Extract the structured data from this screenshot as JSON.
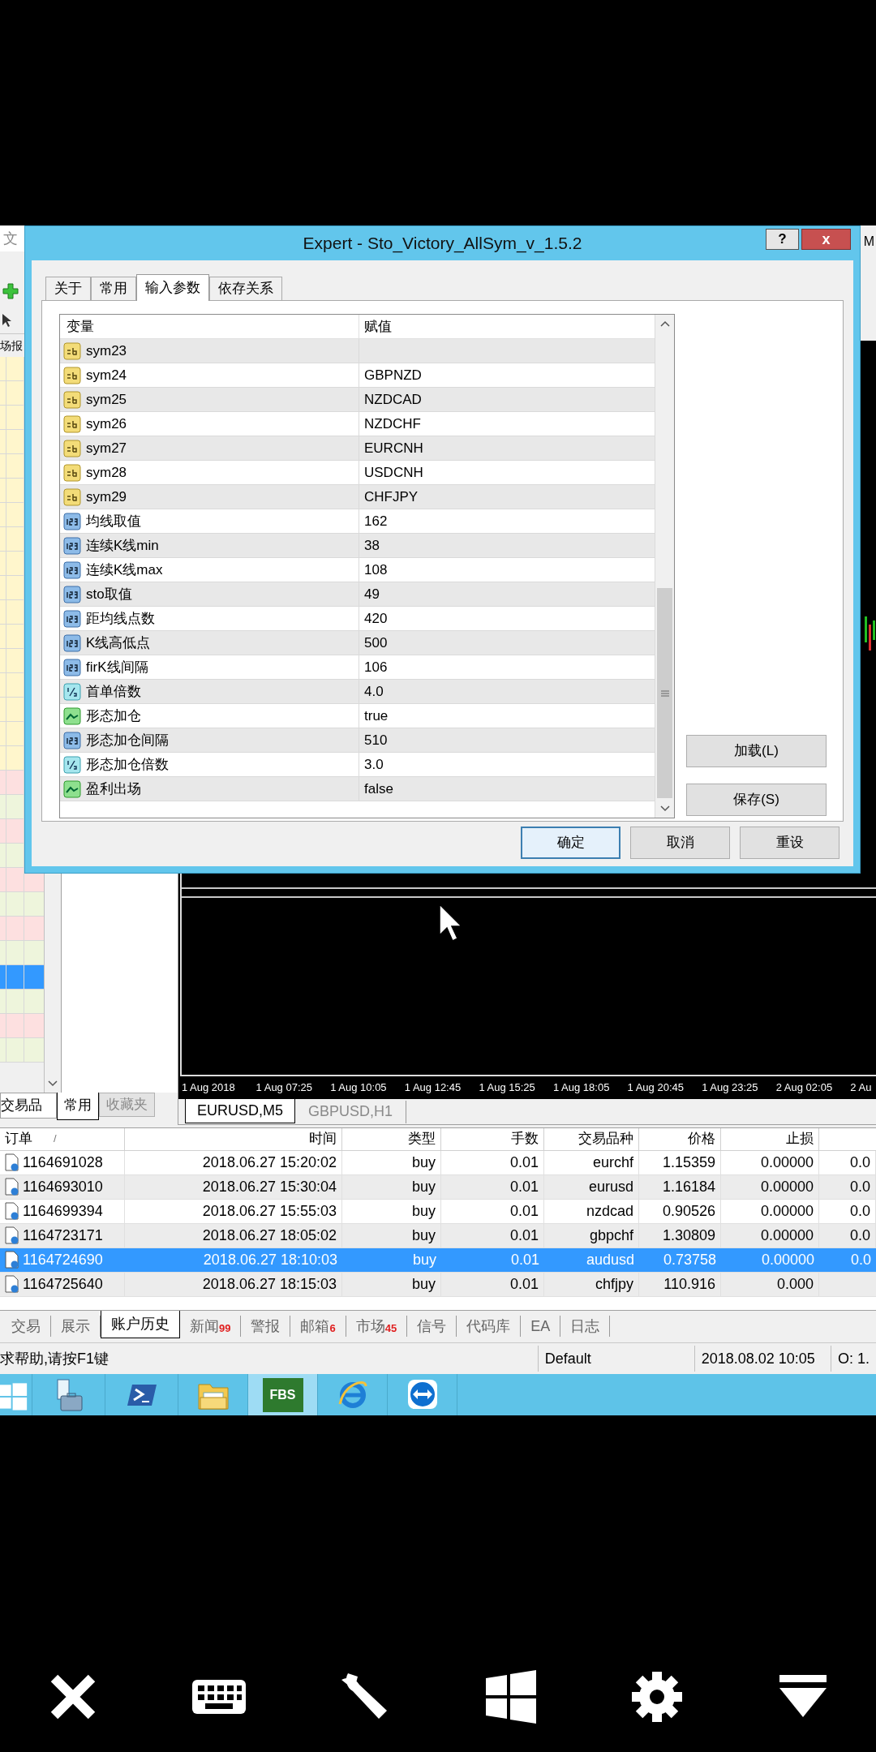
{
  "background_window": {
    "menu_text": "文",
    "edge_text": "M",
    "panel_header": "场报",
    "symbols_tab": "交易品",
    "navigator_tabs": [
      {
        "label": "常用",
        "selected": true
      },
      {
        "label": "收藏夹",
        "selected": false
      }
    ]
  },
  "chart": {
    "time_labels": [
      "1 Aug 2018",
      "1 Aug 07:25",
      "1 Aug 10:05",
      "1 Aug 12:45",
      "1 Aug 15:25",
      "1 Aug 18:05",
      "1 Aug 20:45",
      "1 Aug 23:25",
      "2 Aug 02:05",
      "2 Au"
    ],
    "tabs": [
      {
        "label": "EURUSD,M5",
        "selected": true
      },
      {
        "label": "GBPUSD,H1",
        "selected": false
      }
    ]
  },
  "dialog": {
    "title": "Expert - Sto_Victory_AllSym_v_1.5.2",
    "help_button": "?",
    "close_button": "x",
    "tabs": [
      {
        "label": "关于",
        "selected": false
      },
      {
        "label": "常用",
        "selected": false
      },
      {
        "label": "输入参数",
        "selected": true
      },
      {
        "label": "依存关系",
        "selected": false
      }
    ],
    "columns": [
      "变量",
      "赋值"
    ],
    "parameters": [
      {
        "kind": "string",
        "name": "sym23"
      },
      {
        "kind": "string",
        "name": "sym24",
        "value": "GBPNZD"
      },
      {
        "kind": "string",
        "name": "sym25",
        "value": "NZDCAD"
      },
      {
        "kind": "string",
        "name": "sym26",
        "value": "NZDCHF"
      },
      {
        "kind": "string",
        "name": "sym27",
        "value": "EURCNH"
      },
      {
        "kind": "string",
        "name": "sym28",
        "value": "USDCNH"
      },
      {
        "kind": "string",
        "name": "sym29",
        "value": "CHFJPY"
      },
      {
        "kind": "int",
        "name": "均线取值",
        "value": "162"
      },
      {
        "kind": "int",
        "name": "连续K线min",
        "value": "38"
      },
      {
        "kind": "int",
        "name": "连续K线max",
        "value": "108"
      },
      {
        "kind": "int",
        "name": "sto取值",
        "value": "49"
      },
      {
        "kind": "int",
        "name": "距均线点数",
        "value": "420"
      },
      {
        "kind": "int",
        "name": "K线高低点",
        "value": "500"
      },
      {
        "kind": "int",
        "name": "firK线间隔",
        "value": "106"
      },
      {
        "kind": "double",
        "name": "首单倍数",
        "value": "4.0"
      },
      {
        "kind": "bool",
        "name": "形态加仓",
        "value": "true"
      },
      {
        "kind": "int",
        "name": "形态加仓间隔",
        "value": "510"
      },
      {
        "kind": "double",
        "name": "形态加仓倍数",
        "value": "3.0"
      },
      {
        "kind": "bool",
        "name": "盈利出场",
        "value": "false"
      }
    ],
    "side_buttons": [
      "加载(L)",
      "保存(S)"
    ],
    "buttons": [
      {
        "label": "确定",
        "default": true
      },
      {
        "label": "取消",
        "default": false
      },
      {
        "label": "重设",
        "default": false
      }
    ]
  },
  "orders": {
    "columns": [
      "订单",
      "时间",
      "类型",
      "手数",
      "交易品种",
      "价格",
      "止损"
    ],
    "sort_indicator": "/",
    "rows": [
      {
        "selected": false,
        "cells": [
          "1164691028",
          "2018.06.27 15:20:02",
          "buy",
          "0.01",
          "eurchf",
          "1.15359",
          "0.00000",
          "0.0"
        ]
      },
      {
        "selected": false,
        "cells": [
          "1164693010",
          "2018.06.27 15:30:04",
          "buy",
          "0.01",
          "eurusd",
          "1.16184",
          "0.00000",
          "0.0"
        ]
      },
      {
        "selected": false,
        "cells": [
          "1164699394",
          "2018.06.27 15:55:03",
          "buy",
          "0.01",
          "nzdcad",
          "0.90526",
          "0.00000",
          "0.0"
        ]
      },
      {
        "selected": false,
        "cells": [
          "1164723171",
          "2018.06.27 18:05:02",
          "buy",
          "0.01",
          "gbpchf",
          "1.30809",
          "0.00000",
          "0.0"
        ]
      },
      {
        "selected": true,
        "cells": [
          "1164724690",
          "2018.06.27 18:10:03",
          "buy",
          "0.01",
          "audusd",
          "0.73758",
          "0.00000",
          "0.0"
        ]
      },
      {
        "selected": false,
        "cells": [
          "1164725640",
          "2018.06.27 18:15:03",
          "buy",
          "0.01",
          "chfjpy",
          "110.916",
          "0.000"
        ]
      }
    ]
  },
  "terminal_tabs": [
    {
      "label": "交易",
      "selected": false
    },
    {
      "label": "展示",
      "selected": false
    },
    {
      "label": "账户历史",
      "selected": true
    },
    {
      "label": "新闻",
      "badge": "99",
      "selected": false
    },
    {
      "label": "警报",
      "selected": false
    },
    {
      "label": "邮箱",
      "badge": "6",
      "selected": false
    },
    {
      "label": "市场",
      "badge": "45",
      "selected": false
    },
    {
      "label": "信号",
      "selected": false
    },
    {
      "label": "代码库",
      "selected": false
    },
    {
      "label": "EA",
      "selected": false
    },
    {
      "label": "日志",
      "selected": false
    }
  ],
  "status_bar": [
    "求帮助,请按F1键",
    "Default",
    "2018.08.02 10:05",
    "O: 1."
  ],
  "taskbar": [
    {
      "kind": "start",
      "selected": false
    },
    {
      "kind": "server",
      "selected": false
    },
    {
      "kind": "powershell",
      "selected": false
    },
    {
      "kind": "explorer",
      "selected": false
    },
    {
      "kind": "fbs",
      "label": "FBS",
      "selected": true
    },
    {
      "kind": "ie",
      "selected": false
    },
    {
      "kind": "teamviewer",
      "selected": false
    }
  ]
}
